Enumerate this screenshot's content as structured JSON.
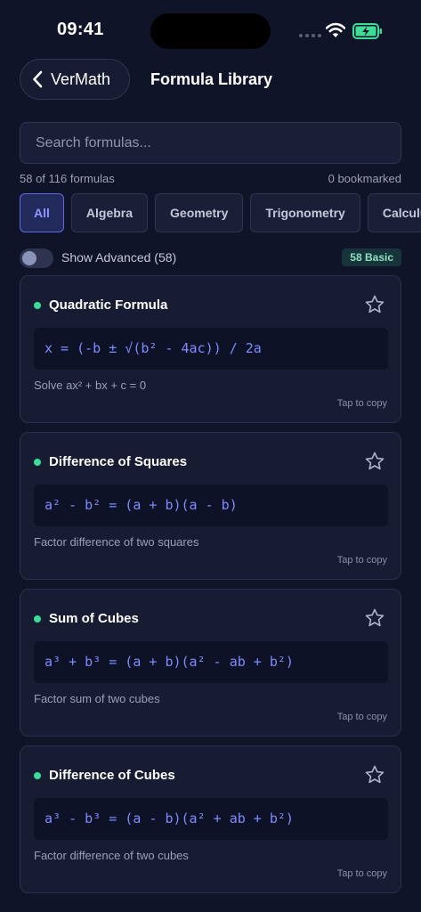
{
  "status": {
    "time": "09:41"
  },
  "nav": {
    "back_label": "VerMath",
    "title": "Formula Library"
  },
  "search": {
    "placeholder": "Search formulas..."
  },
  "meta": {
    "count": "58 of 116 formulas",
    "bookmarked": "0 bookmarked"
  },
  "categories": [
    "All",
    "Algebra",
    "Geometry",
    "Trigonometry",
    "Calculus"
  ],
  "active_category": "All",
  "toggle": {
    "label": "Show Advanced (58)",
    "on": false,
    "badge": "58 Basic"
  },
  "copy_hint": "Tap to copy",
  "formulas": [
    {
      "title": "Quadratic Formula",
      "expr": "x = (-b ± √(b² - 4ac)) / 2a",
      "desc": "Solve ax² + bx + c = 0",
      "bookmarked": false
    },
    {
      "title": "Difference of Squares",
      "expr": "a² - b² = (a + b)(a - b)",
      "desc": "Factor difference of two squares",
      "bookmarked": false
    },
    {
      "title": "Sum of Cubes",
      "expr": "a³ + b³ = (a + b)(a² - ab + b²)",
      "desc": "Factor sum of two cubes",
      "bookmarked": false
    },
    {
      "title": "Difference of Cubes",
      "expr": "a³ - b³ = (a - b)(a² + ab + b²)",
      "desc": "Factor difference of two cubes",
      "bookmarked": false
    }
  ],
  "colors": {
    "background": "#101428",
    "accent": "#7f8bff",
    "basic_dot": "#3ddc97",
    "battery": "#3ddc97"
  }
}
